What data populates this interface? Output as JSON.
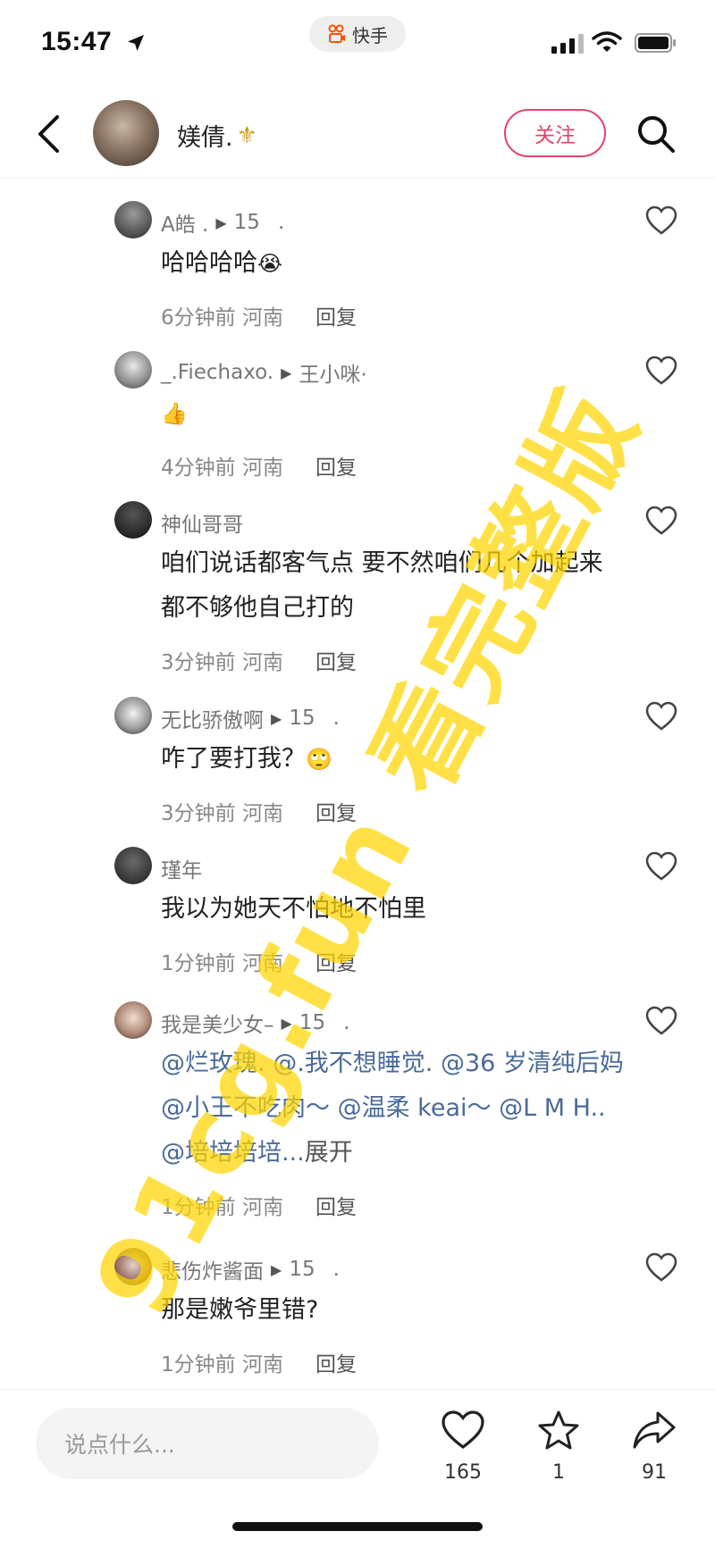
{
  "status_bar": {
    "time": "15:47",
    "app_name": "快手"
  },
  "header": {
    "username": "媄倩.",
    "username_badge": "⚜",
    "follow_label": "关注"
  },
  "comments": [
    {
      "name": "A皓 .",
      "reply_to": "15",
      "tail": ".",
      "text": "哈哈哈哈",
      "emoji": "😭",
      "time": "6分钟前",
      "location": "河南",
      "reply_label": "回复"
    },
    {
      "name": "_.Fiechaxo.",
      "reply_to": "王小咪·",
      "tail": "",
      "text": "",
      "emoji": "👍",
      "time": "4分钟前",
      "location": "河南",
      "reply_label": "回复"
    },
    {
      "name": "神仙哥哥",
      "text": "咱们说话都客气点 要不然咱们几个加起来都不够他自己打的",
      "time": "3分钟前",
      "location": "河南",
      "reply_label": "回复"
    },
    {
      "name": "无比骄傲啊",
      "reply_to": "15",
      "tail": ".",
      "text": "咋了要打我？",
      "emoji": "🙄",
      "time": "3分钟前",
      "location": "河南",
      "reply_label": "回复"
    },
    {
      "name": "瑾年",
      "text": "我以为她天不怕地不怕里",
      "time": "1分钟前",
      "location": "河南",
      "reply_label": "回复"
    },
    {
      "name": "我是美少女–",
      "reply_to": "15",
      "tail": ".",
      "mentions": [
        "@烂玫瑰.",
        "@.我不想睡觉.",
        "@36 岁清纯后妈",
        "@小王不吃肉～",
        "@温柔 keai～",
        "@L M H..",
        "@培培培培..."
      ],
      "expand_label": "展开",
      "time": "1分钟前",
      "location": "河南",
      "reply_label": "回复"
    },
    {
      "name": "悲伤炸酱面",
      "reply_to": "15",
      "tail": ".",
      "text": "那是嫩爷里错?",
      "time": "1分钟前",
      "location": "河南",
      "reply_label": "回复"
    }
  ],
  "bottom_bar": {
    "input_placeholder": "说点什么...",
    "like_count": "165",
    "star_count": "1",
    "share_count": "91"
  },
  "watermark": "91cg.fun 看完整版",
  "colors": {
    "accent_pink": "#e0456a",
    "mention_blue": "#4a6a9a",
    "watermark_yellow": "#ffd500"
  }
}
